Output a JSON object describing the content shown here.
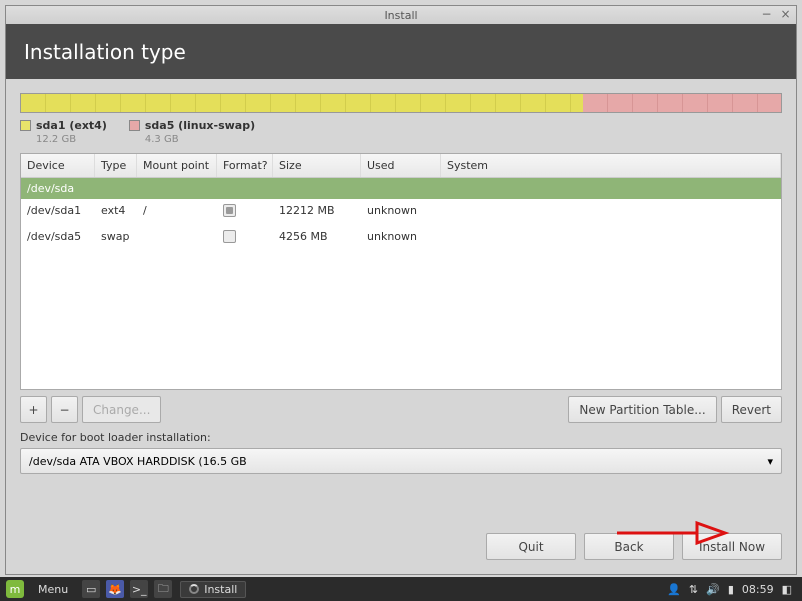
{
  "titlebar": {
    "title": "Install"
  },
  "header": {
    "title": "Installation type"
  },
  "legend": {
    "p1": {
      "name": "sda1 (ext4)",
      "size": "12.2 GB"
    },
    "p2": {
      "name": "sda5 (linux-swap)",
      "size": "4.3 GB"
    }
  },
  "disk": {
    "seg1_pct": 74,
    "seg2_pct": 26
  },
  "table": {
    "headers": {
      "device": "Device",
      "type": "Type",
      "mount": "Mount point",
      "format": "Format?",
      "size": "Size",
      "used": "Used",
      "system": "System"
    },
    "group": "/dev/sda",
    "rows": [
      {
        "device": "/dev/sda1",
        "type": "ext4",
        "mount": "/",
        "format": "mixed",
        "size": "12212 MB",
        "used": "unknown",
        "system": ""
      },
      {
        "device": "/dev/sda5",
        "type": "swap",
        "mount": "",
        "format": "off",
        "size": "4256 MB",
        "used": "unknown",
        "system": ""
      }
    ]
  },
  "buttons": {
    "plus": "+",
    "minus": "−",
    "change": "Change...",
    "newtable": "New Partition Table...",
    "revert": "Revert",
    "quit": "Quit",
    "back": "Back",
    "install": "Install Now"
  },
  "boot": {
    "label": "Device for boot loader installation:",
    "value": "/dev/sda   ATA VBOX HARDDISK (16.5 GB"
  },
  "taskbar": {
    "menu": "Menu",
    "task": "Install",
    "time": "08:59"
  }
}
